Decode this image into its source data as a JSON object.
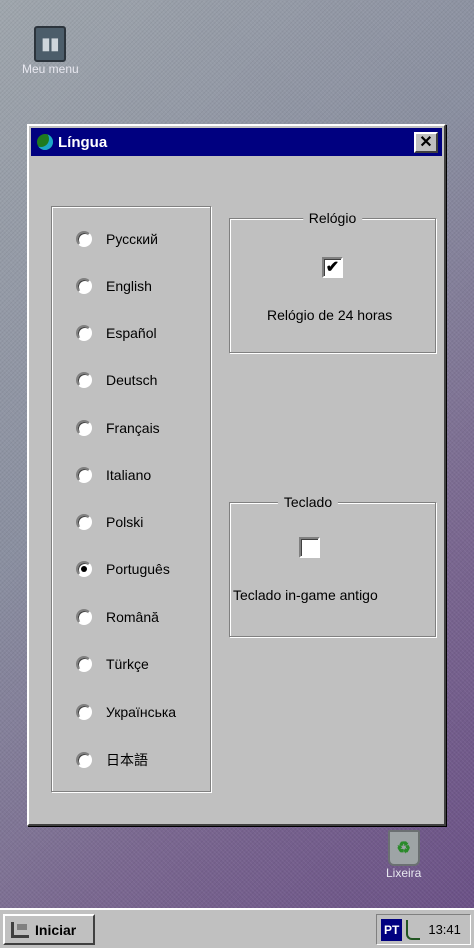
{
  "desktop": {
    "menu_icon_label": "Meu menu",
    "trash_label": "Lixeira"
  },
  "window": {
    "title": "Língua",
    "close_glyph": "✕"
  },
  "languages": {
    "selected": "Português",
    "items": [
      "Русский",
      "English",
      "Español",
      "Deutsch",
      "Français",
      "Italiano",
      "Polski",
      "Português",
      "Română",
      "Türkçe",
      "Українська",
      "日本語"
    ]
  },
  "clock_group": {
    "title": "Relógio",
    "checkbox_label": "Relógio de 24 horas",
    "checked": true
  },
  "keyboard_group": {
    "title": "Teclado",
    "checkbox_label": "Teclado in-game antigo",
    "checked": false
  },
  "taskbar": {
    "start_label": "Iniciar",
    "language_indicator": "PT",
    "time": "13:41"
  },
  "icons": [
    "globe-icon",
    "close-icon",
    "start-icon",
    "plug-icon",
    "menu-icon",
    "trash-icon"
  ],
  "colors": {
    "titlebar": "#000080",
    "face": "#c0c0c0"
  }
}
